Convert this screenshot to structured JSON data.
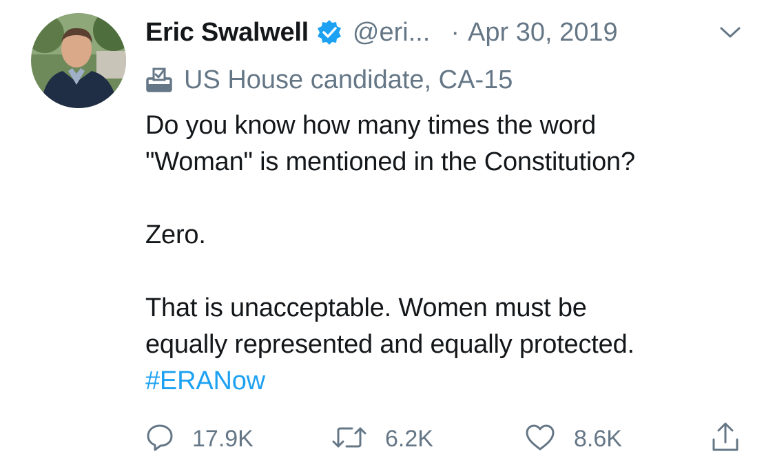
{
  "author": {
    "name": "Eric Swalwell",
    "handle": "@eri...",
    "separator": "·",
    "date": "Apr 30, 2019",
    "verified": true
  },
  "label": {
    "icon": "ballot-box-icon",
    "text": "US House candidate, CA-15"
  },
  "tweet": {
    "line1": "Do you know how many times the word",
    "line2": "\"Woman\" is mentioned in the Constitution?",
    "line3": "Zero.",
    "line4": "That is unacceptable. Women must be",
    "line5": "equally represented and equally protected.",
    "hashtag": "#ERANow"
  },
  "actions": {
    "reply": {
      "icon": "reply-icon",
      "count": "17.9K"
    },
    "retweet": {
      "icon": "retweet-icon",
      "count": "6.2K"
    },
    "like": {
      "icon": "heart-icon",
      "count": "8.6K"
    },
    "share": {
      "icon": "share-icon"
    }
  },
  "colors": {
    "text": "#14171a",
    "muted": "#657786",
    "accent": "#1da1f2"
  }
}
